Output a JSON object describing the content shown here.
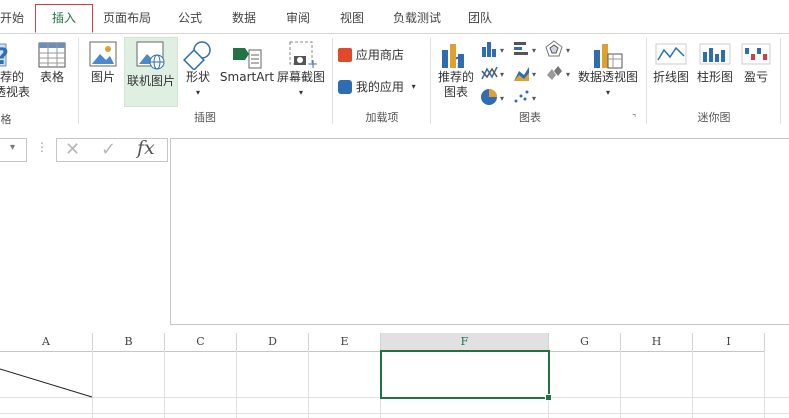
{
  "tabs": [
    "开始",
    "插入",
    "页面布局",
    "公式",
    "数据",
    "审阅",
    "视图",
    "负载测试",
    "团队"
  ],
  "active_tab": "插入",
  "ribbon": {
    "pivot_partial": [
      "荐的",
      "透视表"
    ],
    "table": "表格",
    "tables_group_partial": "格",
    "picture": "图片",
    "online_picture": "联机图片",
    "shapes": "形状",
    "smartart": "SmartArt",
    "screenshot": "屏幕截图",
    "illustrations_group": "插图",
    "app_store": "应用商店",
    "my_apps": "我的应用",
    "addins_group": "加载项",
    "recommended_charts": [
      "推荐的",
      "图表"
    ],
    "pivot_chart": "数据透视图",
    "charts_group": "图表",
    "spark_line": "折线图",
    "spark_column": "柱形图",
    "spark_winloss": "盈亏",
    "sparklines_group": "迷你图"
  },
  "formula_bar": {
    "fx_label": "fx",
    "content": ""
  },
  "columns": [
    "A",
    "B",
    "C",
    "D",
    "E",
    "F",
    "G",
    "H",
    "I"
  ],
  "selected_cell": "F",
  "colors": {
    "accent": "#217346",
    "active_tab_border": "#d04040",
    "selection": "#217346"
  }
}
